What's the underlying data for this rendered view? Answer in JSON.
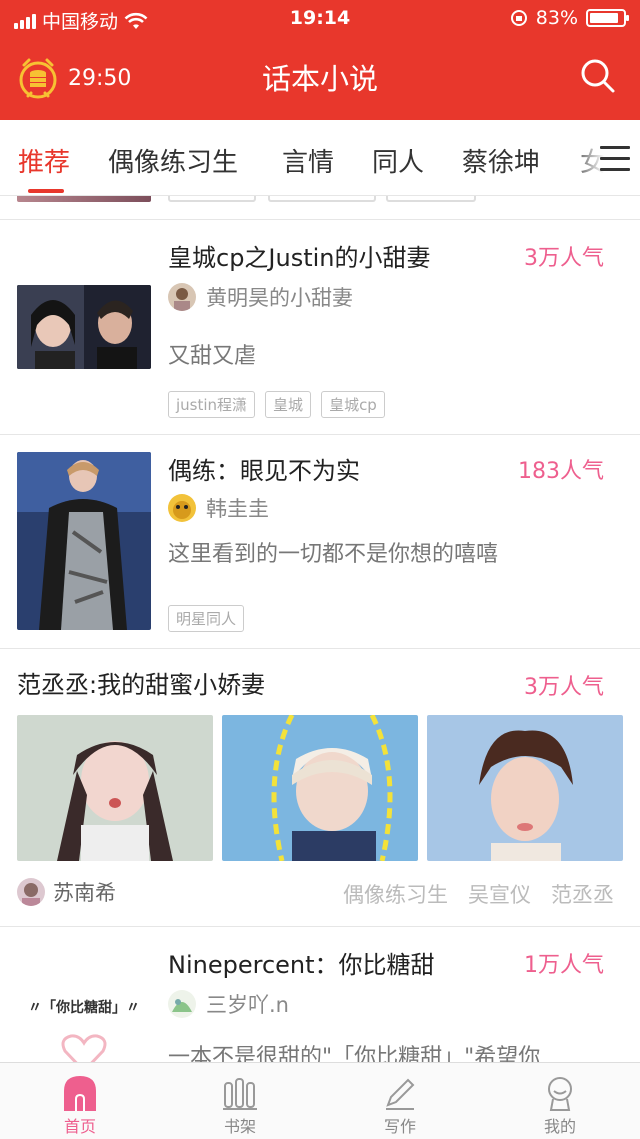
{
  "status_bar": {
    "carrier": "中国移动",
    "time": "19:14",
    "battery": "83%"
  },
  "header": {
    "timer": "29:50",
    "title": "话本小说"
  },
  "tabs": [
    {
      "label": "推荐",
      "active": true
    },
    {
      "label": "偶像练习生"
    },
    {
      "label": "言情"
    },
    {
      "label": "同人"
    },
    {
      "label": "蔡徐坤"
    },
    {
      "label": "女"
    }
  ],
  "books": [
    {
      "title": "皇城cp之Justin的小甜妻",
      "popularity": "3万人气",
      "author": "黄明昊的小甜妻",
      "description": "又甜又虐",
      "tags": [
        "justin程潇",
        "皇城",
        "皇城cp"
      ]
    },
    {
      "title": "偶练：眼见不为实",
      "popularity": "183人气",
      "author": "韩圭圭",
      "description": "这里看到的一切都不是你想的嘻嘻",
      "tags": [
        "明星同人"
      ]
    }
  ],
  "featured": {
    "title": "范丞丞:我的甜蜜小娇妻",
    "popularity": "3万人气",
    "author": "苏南希",
    "tags": [
      "偶像练习生",
      "吴宣仪",
      "范丞丞"
    ]
  },
  "last_book": {
    "title": "Ninepercent：你比糖甜",
    "popularity": "1万人气",
    "author": "三岁吖.n",
    "description": "一本不是很甜的\"「你比糖甜」\"希望你",
    "cover_text": "〃「你比糖甜」〃"
  },
  "tabbar": [
    {
      "label": "首页",
      "icon": "home-icon",
      "active": true
    },
    {
      "label": "书架",
      "icon": "bookshelf-icon"
    },
    {
      "label": "写作",
      "icon": "pen-icon"
    },
    {
      "label": "我的",
      "icon": "profile-icon"
    }
  ],
  "colors": {
    "brand": "#e8372c",
    "popularity": "#ee5f8e"
  }
}
